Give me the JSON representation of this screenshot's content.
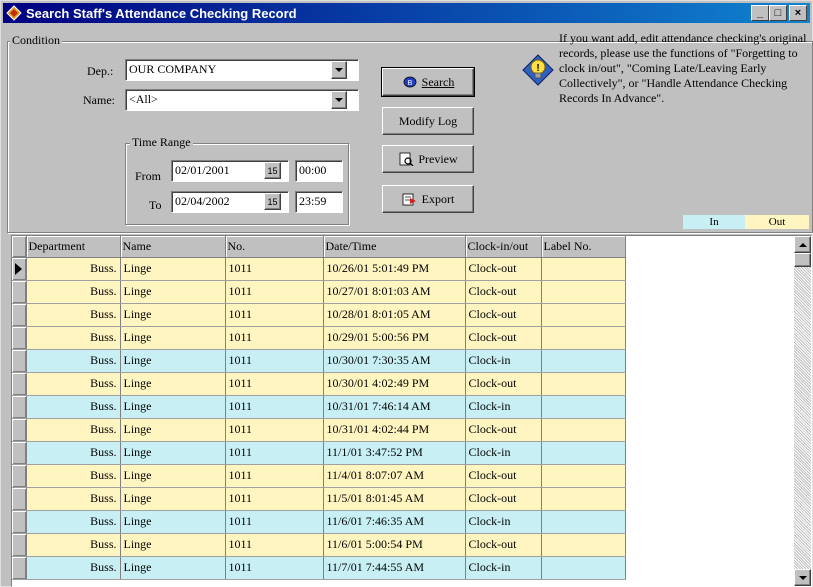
{
  "window": {
    "title": "Search Staff's Attendance Checking Record",
    "controls": {
      "minimize": "_",
      "maximize": "□",
      "close": "×"
    }
  },
  "condition": {
    "group_label": "Condition",
    "dep_label": "Dep.:",
    "dep_value": "OUR COMPANY",
    "name_label": "Name:",
    "name_value": "<All>",
    "time_range": {
      "group_label": "Time Range",
      "from_label": "From",
      "from_date": "02/01/2001",
      "from_time": "00:00",
      "to_label": "To",
      "to_date": "02/04/2002",
      "to_time": "23:59",
      "calendar_glyph": "15"
    }
  },
  "buttons": {
    "search": "Search",
    "modify_log": "Modify Log",
    "preview": "Preview",
    "export": "Export"
  },
  "info_text": "If you want add, edit attendance checking's original records, please use the functions of \"Forgetting to clock in/out\", \"Coming Late/Leaving Early Collectively\", or \"Handle Attendance Checking Records In Advance\".",
  "legend": {
    "in": "In",
    "out": "Out",
    "in_color": "#c8f0f4",
    "out_color": "#fff5c0"
  },
  "table": {
    "columns": [
      "Department",
      "Name",
      "No.",
      "Date/Time",
      "Clock-in/out",
      "Label No."
    ],
    "rows": [
      {
        "dept": "Buss.",
        "name": "Linge",
        "no": "1011",
        "datetime": "10/26/01 5:01:49 PM",
        "clock": "Clock-out",
        "label": ""
      },
      {
        "dept": "Buss.",
        "name": "Linge",
        "no": "1011",
        "datetime": "10/27/01 8:01:03 AM",
        "clock": "Clock-out",
        "label": ""
      },
      {
        "dept": "Buss.",
        "name": "Linge",
        "no": "1011",
        "datetime": "10/28/01 8:01:05 AM",
        "clock": "Clock-out",
        "label": ""
      },
      {
        "dept": "Buss.",
        "name": "Linge",
        "no": "1011",
        "datetime": "10/29/01 5:00:56 PM",
        "clock": "Clock-out",
        "label": ""
      },
      {
        "dept": "Buss.",
        "name": "Linge",
        "no": "1011",
        "datetime": "10/30/01 7:30:35 AM",
        "clock": "Clock-in",
        "label": ""
      },
      {
        "dept": "Buss.",
        "name": "Linge",
        "no": "1011",
        "datetime": "10/30/01 4:02:49 PM",
        "clock": "Clock-out",
        "label": ""
      },
      {
        "dept": "Buss.",
        "name": "Linge",
        "no": "1011",
        "datetime": "10/31/01 7:46:14 AM",
        "clock": "Clock-in",
        "label": ""
      },
      {
        "dept": "Buss.",
        "name": "Linge",
        "no": "1011",
        "datetime": "10/31/01 4:02:44 PM",
        "clock": "Clock-out",
        "label": ""
      },
      {
        "dept": "Buss.",
        "name": "Linge",
        "no": "1011",
        "datetime": "11/1/01 3:47:52 PM",
        "clock": "Clock-in",
        "label": ""
      },
      {
        "dept": "Buss.",
        "name": "Linge",
        "no": "1011",
        "datetime": "11/4/01 8:07:07 AM",
        "clock": "Clock-out",
        "label": ""
      },
      {
        "dept": "Buss.",
        "name": "Linge",
        "no": "1011",
        "datetime": "11/5/01 8:01:45 AM",
        "clock": "Clock-out",
        "label": ""
      },
      {
        "dept": "Buss.",
        "name": "Linge",
        "no": "1011",
        "datetime": "11/6/01 7:46:35 AM",
        "clock": "Clock-in",
        "label": ""
      },
      {
        "dept": "Buss.",
        "name": "Linge",
        "no": "1011",
        "datetime": "11/6/01 5:00:54 PM",
        "clock": "Clock-out",
        "label": ""
      },
      {
        "dept": "Buss.",
        "name": "Linge",
        "no": "1011",
        "datetime": "11/7/01 7:44:55 AM",
        "clock": "Clock-in",
        "label": ""
      }
    ]
  }
}
